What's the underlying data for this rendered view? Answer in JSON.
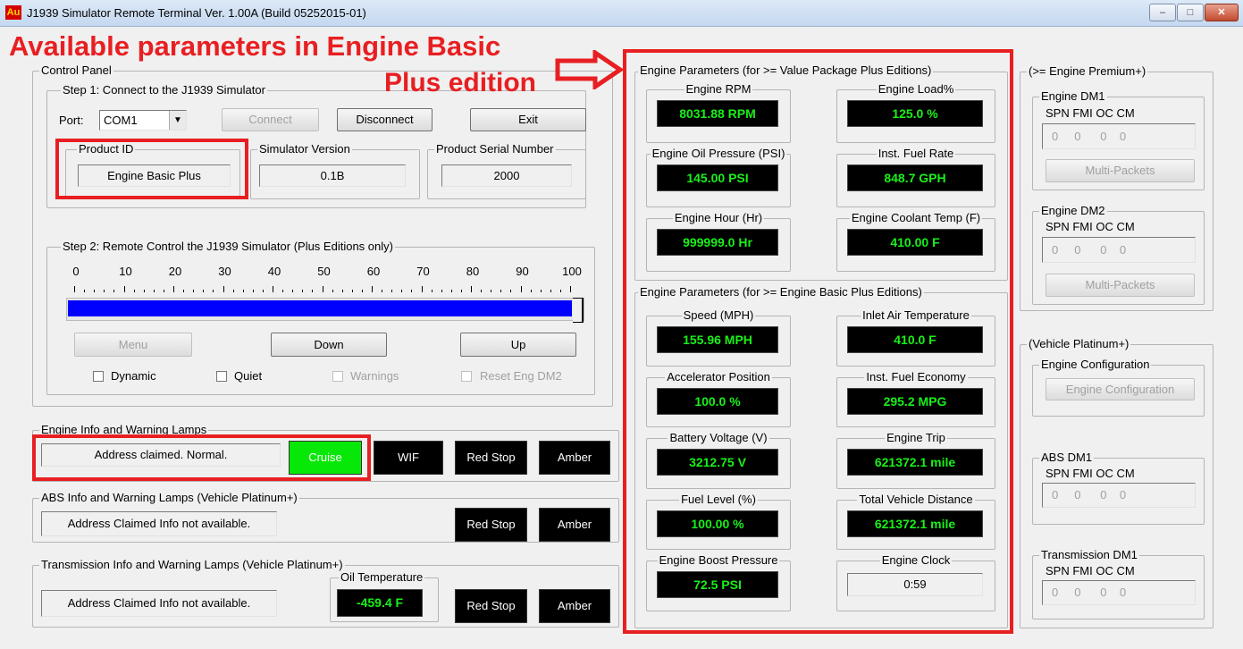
{
  "window": {
    "app_icon": "Au",
    "title": "J1939 Simulator Remote Terminal Ver. 1.00A (Build 05252015-01)"
  },
  "annotations": {
    "line1": "Available parameters  in  Engine Basic",
    "line2": "Plus edition",
    "arrow_icon": "right-arrow-icon"
  },
  "control_panel": {
    "title": "Control Panel",
    "step1": {
      "title": "Step 1: Connect to the J1939 Simulator",
      "port_label": "Port:",
      "port_value": "COM1",
      "connect": "Connect",
      "disconnect": "Disconnect",
      "exit": "Exit",
      "product_id_label": "Product ID",
      "product_id": "Engine Basic Plus",
      "sim_version_label": "Simulator Version",
      "sim_version": "0.1B",
      "serial_label": "Product Serial Number",
      "serial": "2000"
    },
    "step2": {
      "title": "Step 2: Remote Control the J1939 Simulator (Plus Editions only)",
      "scale": [
        "0",
        "10",
        "20",
        "30",
        "40",
        "50",
        "60",
        "70",
        "80",
        "90",
        "100"
      ],
      "progress_percent": 100,
      "menu": "Menu",
      "down": "Down",
      "up": "Up",
      "dynamic": "Dynamic",
      "quiet": "Quiet",
      "warnings": "Warnings",
      "reset": "Reset Eng DM2"
    }
  },
  "engine_info": {
    "title": "Engine Info and Warning Lamps",
    "status": "Address claimed. Normal.",
    "cruise": "Cruise",
    "wif": "WIF",
    "red_stop": "Red Stop",
    "amber": "Amber"
  },
  "abs_info": {
    "title": "ABS Info and Warning Lamps (Vehicle Platinum+)",
    "status": "Address Claimed Info not available.",
    "red_stop": "Red Stop",
    "amber": "Amber"
  },
  "trans_info": {
    "title": "Transmission Info and Warning Lamps (Vehicle Platinum+)",
    "status": "Address Claimed Info not available.",
    "oil_temp_label": "Oil Temperature",
    "oil_temp": "-459.4 F",
    "red_stop": "Red Stop",
    "amber": "Amber"
  },
  "vp_params": {
    "title": "Engine Parameters (for >= Value Package Plus Editions)",
    "items": [
      {
        "label": "Engine RPM",
        "value": "8031.88 RPM"
      },
      {
        "label": "Engine Load%",
        "value": "125.0 %"
      },
      {
        "label": "Engine Oil Pressure (PSI)",
        "value": "145.00 PSI"
      },
      {
        "label": "Inst. Fuel Rate",
        "value": "848.7 GPH"
      },
      {
        "label": "Engine Hour (Hr)",
        "value": "999999.0 Hr"
      },
      {
        "label": "Engine Coolant Temp (F)",
        "value": "410.00 F"
      }
    ]
  },
  "eb_params": {
    "title": "Engine Parameters (for >= Engine Basic Plus Editions)",
    "items": [
      {
        "label": "Speed (MPH)",
        "value": "155.96 MPH"
      },
      {
        "label": "Inlet Air Temperature",
        "value": "410.0 F"
      },
      {
        "label": "Accelerator Position",
        "value": "100.0 %"
      },
      {
        "label": "Inst. Fuel Economy",
        "value": "295.2 MPG"
      },
      {
        "label": "Battery Voltage (V)",
        "value": "3212.75 V"
      },
      {
        "label": "Engine Trip",
        "value": "621372.1 mile"
      },
      {
        "label": "Fuel Level (%)",
        "value": "100.00 %"
      },
      {
        "label": "Total Vehicle Distance",
        "value": "621372.1 mile"
      },
      {
        "label": "Engine Boost Pressure",
        "value": "72.5 PSI"
      },
      {
        "label": "Engine Clock",
        "value": "0:59"
      }
    ]
  },
  "premium": {
    "title": "(>= Engine Premium+)",
    "dm1_title": "Engine DM1",
    "dm2_title": "Engine DM2",
    "dm_headers": "SPN  FMI  OC  CM",
    "dm_values": "0     0      0    0",
    "multi_packets": "Multi-Packets"
  },
  "platinum": {
    "title": "(Vehicle Platinum+)",
    "config_title": "Engine Configuration",
    "config_button": "Engine Configuration",
    "abs_dm1_title": "ABS DM1",
    "trans_dm1_title": "Transmission DM1",
    "dm_headers": "SPN  FMI  OC  CM",
    "dm_values": "0     0      0    0"
  },
  "colors": {
    "annotation_red": "#e81f22",
    "lcd_text": "#19f019",
    "progress": "#0000ff",
    "cruise_green": "#08e808"
  }
}
